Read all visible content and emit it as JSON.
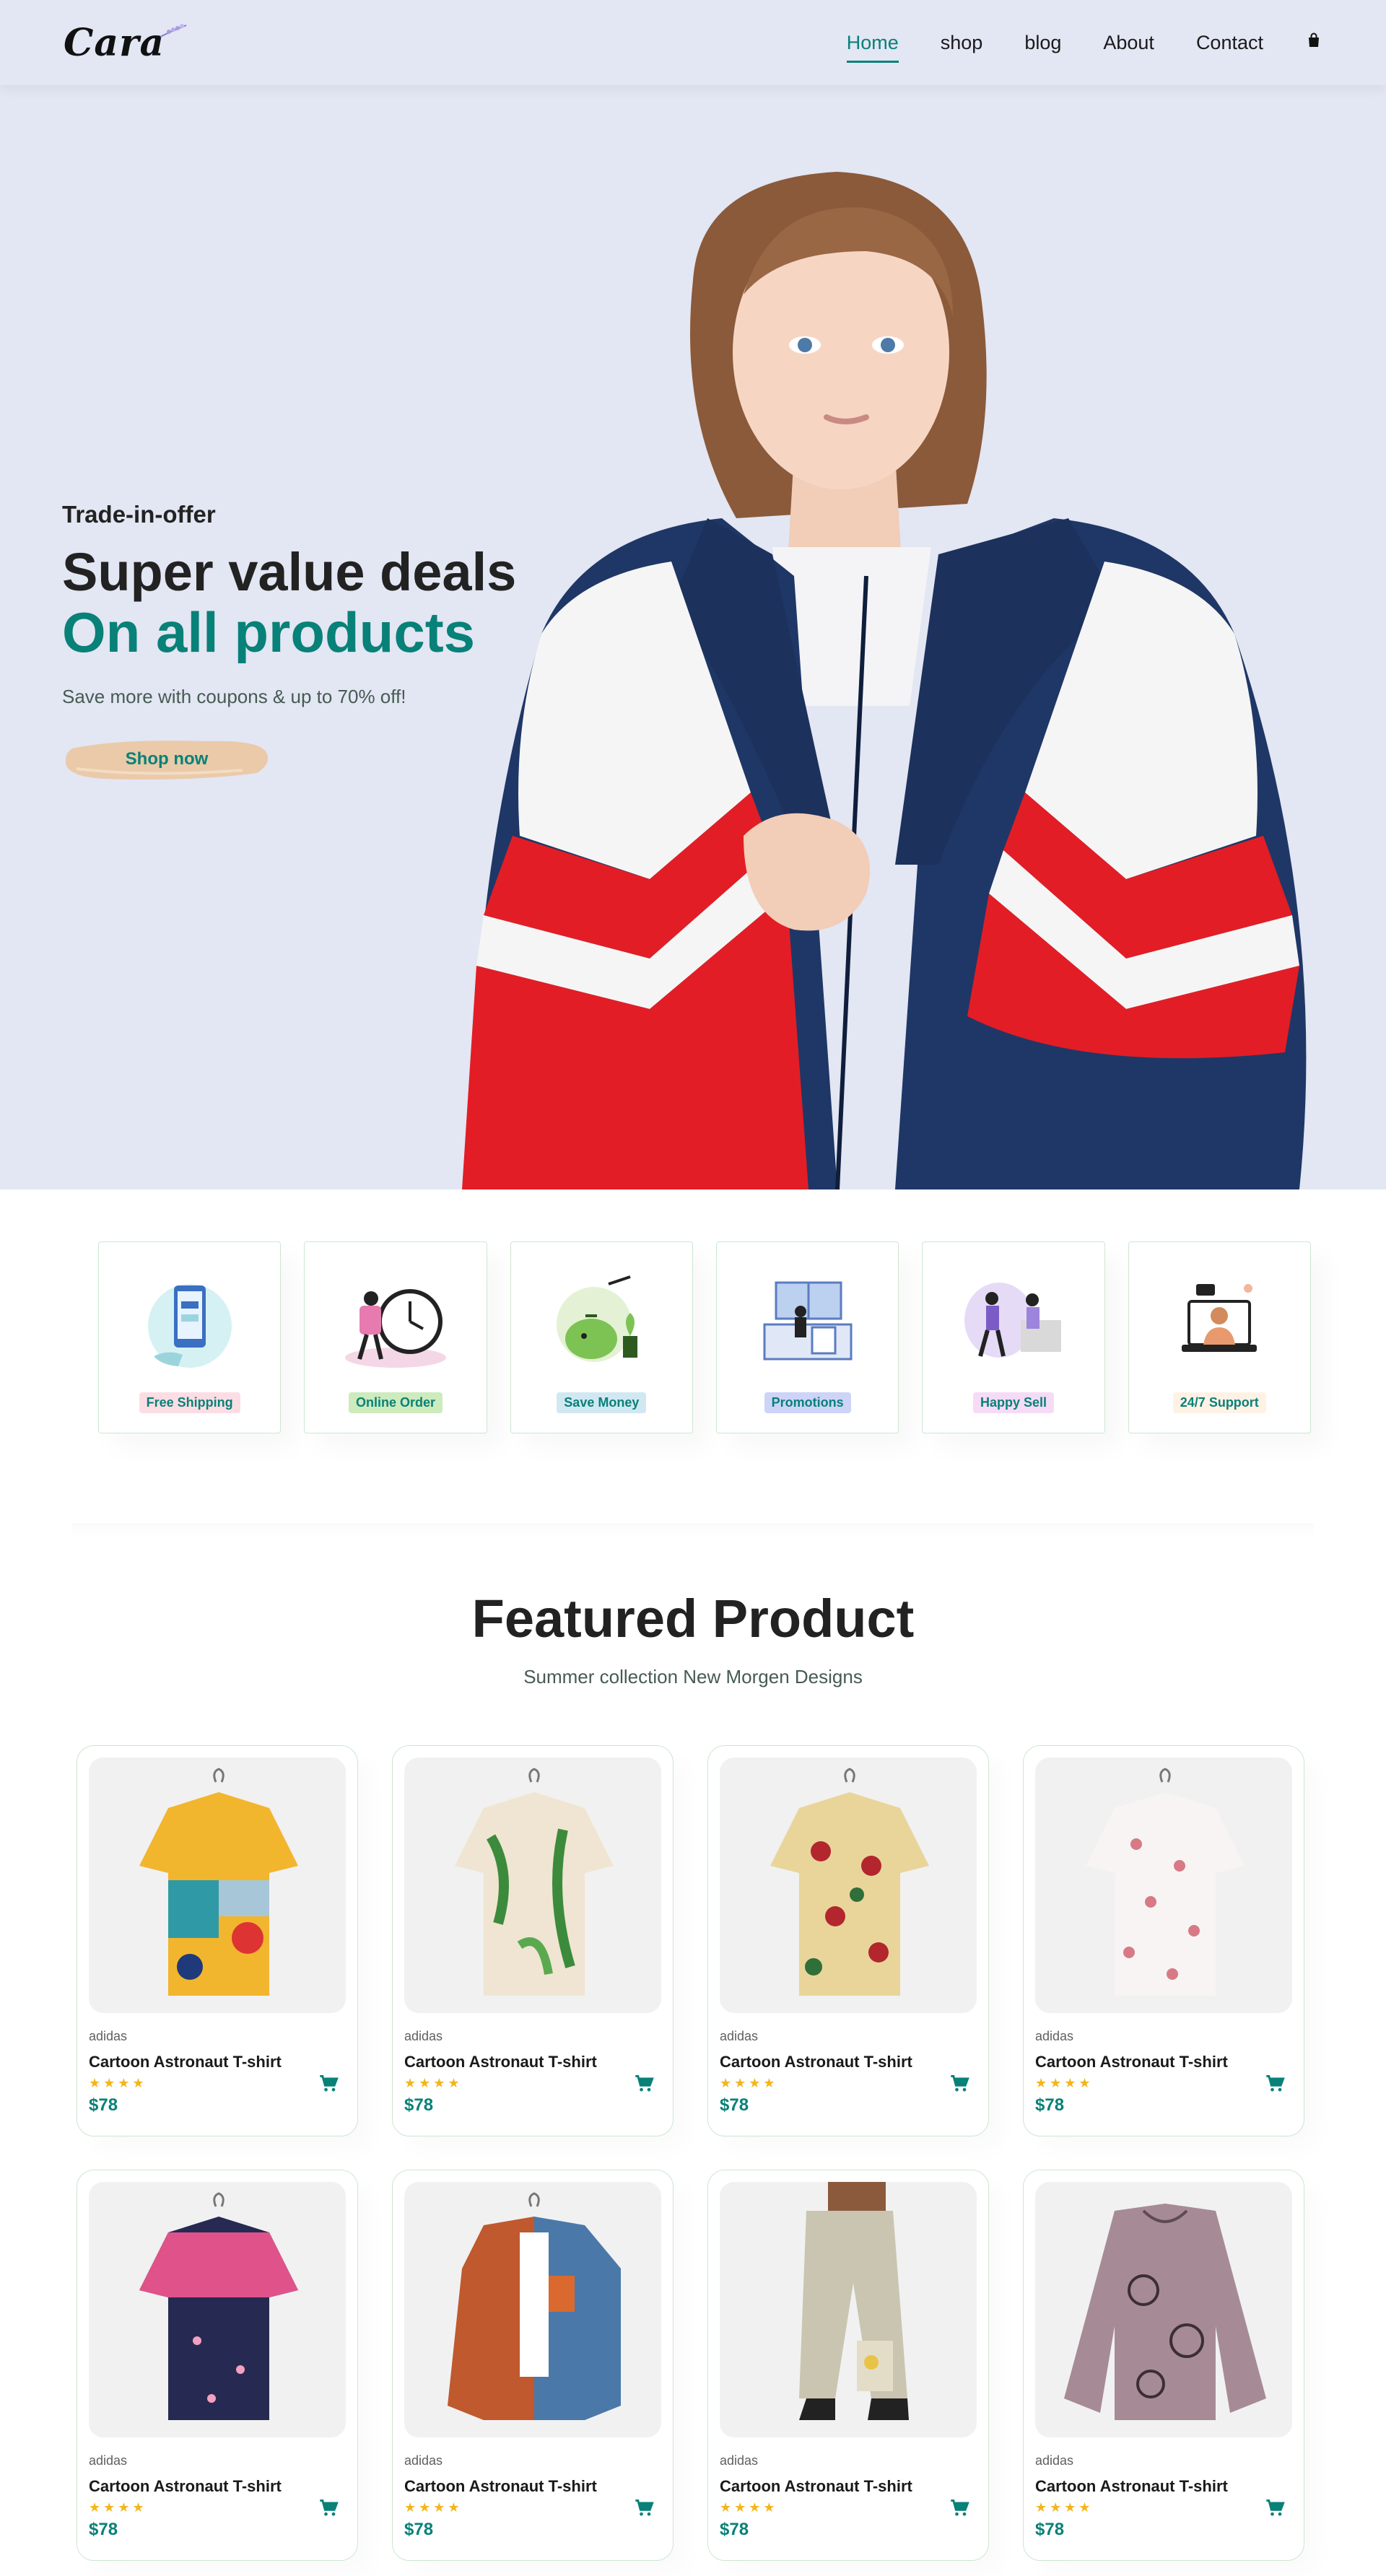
{
  "header": {
    "logo": "Cara",
    "nav": [
      {
        "label": "Home",
        "active": true
      },
      {
        "label": "shop"
      },
      {
        "label": "blog"
      },
      {
        "label": "About"
      },
      {
        "label": "Contact"
      }
    ],
    "cart_icon": "shopping-bag-icon"
  },
  "hero": {
    "offer": "Trade-in-offer",
    "title1": "Super value deals",
    "title2": "On all products",
    "subtitle": "Save more with coupons & up to 70% off!",
    "button": "Shop now"
  },
  "features": [
    {
      "label": "Free Shipping",
      "tag_bg": "#fddde4"
    },
    {
      "label": "Online Order",
      "tag_bg": "#cdebbc"
    },
    {
      "label": "Save Money",
      "tag_bg": "#d1e8f2"
    },
    {
      "label": "Promotions",
      "tag_bg": "#cdd4f8"
    },
    {
      "label": "Happy Sell",
      "tag_bg": "#f6dbf6"
    },
    {
      "label": "24/7 Support",
      "tag_bg": "#fff2e5"
    }
  ],
  "featured": {
    "title": "Featured Product",
    "subtitle": "Summer collection New Morgen Designs",
    "products": [
      {
        "brand": "adidas",
        "name": "Cartoon Astronaut T-shirt",
        "stars": "★★★★",
        "rating": 4,
        "price": "$78"
      },
      {
        "brand": "adidas",
        "name": "Cartoon Astronaut T-shirt",
        "stars": "★★★★",
        "rating": 4,
        "price": "$78"
      },
      {
        "brand": "adidas",
        "name": "Cartoon Astronaut T-shirt",
        "stars": "★★★★",
        "rating": 4,
        "price": "$78"
      },
      {
        "brand": "adidas",
        "name": "Cartoon Astronaut T-shirt",
        "stars": "★★★★",
        "rating": 4,
        "price": "$78"
      },
      {
        "brand": "adidas",
        "name": "Cartoon Astronaut T-shirt",
        "stars": "★★★★",
        "rating": 4,
        "price": "$78"
      },
      {
        "brand": "adidas",
        "name": "Cartoon Astronaut T-shirt",
        "stars": "★★★★",
        "rating": 4,
        "price": "$78"
      },
      {
        "brand": "adidas",
        "name": "Cartoon Astronaut T-shirt",
        "stars": "★★★★",
        "rating": 4,
        "price": "$78"
      },
      {
        "brand": "adidas",
        "name": "Cartoon Astronaut T-shirt",
        "stars": "★★★★",
        "rating": 4,
        "price": "$78"
      }
    ]
  },
  "colors": {
    "accent": "#088178",
    "hero_bg": "#e3e6f3",
    "star": "#f3b519"
  }
}
